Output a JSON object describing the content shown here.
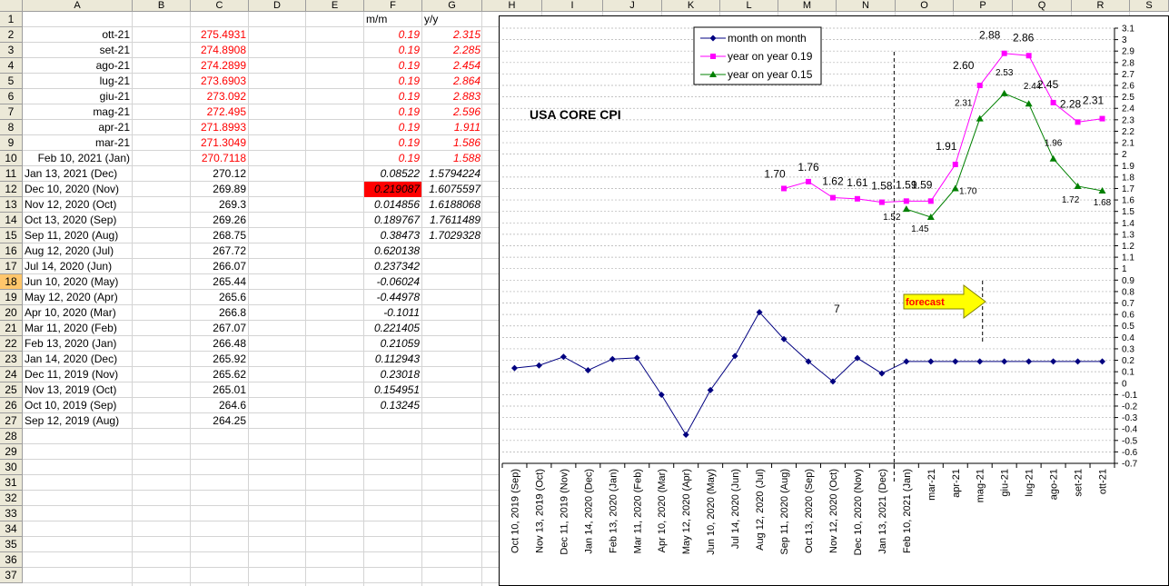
{
  "columns": [
    "A",
    "B",
    "C",
    "D",
    "E",
    "F",
    "G",
    "H",
    "I",
    "J",
    "K",
    "L",
    "M",
    "N",
    "O",
    "P",
    "Q",
    "R",
    "S"
  ],
  "header_row": {
    "F": "m/m",
    "G": "y/y"
  },
  "rows": [
    {
      "a": "ott-21",
      "c": "275.4931",
      "f": "0.19",
      "g": "2.315",
      "forecast": true
    },
    {
      "a": "set-21",
      "c": "274.8908",
      "f": "0.19",
      "g": "2.285",
      "forecast": true
    },
    {
      "a": "ago-21",
      "c": "274.2899",
      "f": "0.19",
      "g": "2.454",
      "forecast": true
    },
    {
      "a": "lug-21",
      "c": "273.6903",
      "f": "0.19",
      "g": "2.864",
      "forecast": true
    },
    {
      "a": "giu-21",
      "c": "273.092",
      "f": "0.19",
      "g": "2.883",
      "forecast": true
    },
    {
      "a": "mag-21",
      "c": "272.495",
      "f": "0.19",
      "g": "2.596",
      "forecast": true
    },
    {
      "a": "apr-21",
      "c": "271.8993",
      "f": "0.19",
      "g": "1.911",
      "forecast": true
    },
    {
      "a": "mar-21",
      "c": "271.3049",
      "f": "0.19",
      "g": "1.586",
      "forecast": true
    },
    {
      "a": "Feb 10, 2021 (Jan)",
      "c": "270.7118",
      "f": "0.19",
      "g": "1.588",
      "forecast": true
    },
    {
      "a": "Jan 13, 2021 (Dec)",
      "c": "270.12",
      "f": "0.08522",
      "g": "1.5794224"
    },
    {
      "a": "Dec 10, 2020 (Nov)",
      "c": "269.89",
      "f": "0.219087",
      "g": "1.6075597",
      "highlight": true
    },
    {
      "a": "Nov 12, 2020 (Oct)",
      "c": "269.3",
      "f": "0.014856",
      "g": "1.6188068"
    },
    {
      "a": "Oct 13, 2020 (Sep)",
      "c": "269.26",
      "f": "0.189767",
      "g": "1.7611489"
    },
    {
      "a": "Sep 11, 2020 (Aug)",
      "c": "268.75",
      "f": "0.38473",
      "g": "1.7029328"
    },
    {
      "a": "Aug 12, 2020 (Jul)",
      "c": "267.72",
      "f": "0.620138",
      "g": ""
    },
    {
      "a": "Jul 14, 2020 (Jun)",
      "c": "266.07",
      "f": "0.237342",
      "g": ""
    },
    {
      "a": "Jun 10, 2020 (May)",
      "c": "265.44",
      "f": "-0.06024",
      "g": ""
    },
    {
      "a": "May 12, 2020 (Apr)",
      "c": "265.6",
      "f": "-0.44978",
      "g": ""
    },
    {
      "a": "Apr 10, 2020 (Mar)",
      "c": "266.8",
      "f": "-0.1011",
      "g": ""
    },
    {
      "a": "Mar 11, 2020 (Feb)",
      "c": "267.07",
      "f": "0.221405",
      "g": ""
    },
    {
      "a": "Feb 13, 2020 (Jan)",
      "c": "266.48",
      "f": "0.21059",
      "g": ""
    },
    {
      "a": "Jan 14, 2020 (Dec)",
      "c": "265.92",
      "f": "0.112943",
      "g": ""
    },
    {
      "a": "Dec 11, 2019 (Nov)",
      "c": "265.62",
      "f": "0.23018",
      "g": ""
    },
    {
      "a": "Nov 13, 2019 (Oct)",
      "c": "265.01",
      "f": "0.154951",
      "g": ""
    },
    {
      "a": "Oct 10, 2019 (Sep)",
      "c": "264.6",
      "f": "0.13245",
      "g": ""
    },
    {
      "a": "Sep 12, 2019 (Aug)",
      "c": "264.25",
      "f": "",
      "g": ""
    }
  ],
  "row_count": 37,
  "selected_row": 18,
  "chart_data": {
    "type": "line",
    "title": "USA CORE CPI",
    "categories": [
      "Oct 10, 2019 (Sep)",
      "Nov 13, 2019 (Oct)",
      "Dec 11, 2019 (Nov)",
      "Jan 14, 2020 (Dec)",
      "Feb 13, 2020 (Jan)",
      "Mar 11, 2020 (Feb)",
      "Apr 10, 2020 (Mar)",
      "May 12, 2020 (Apr)",
      "Jun 10, 2020 (May)",
      "Jul 14, 2020 (Jun)",
      "Aug 12, 2020 (Jul)",
      "Sep 11, 2020 (Aug)",
      "Oct 13, 2020 (Sep)",
      "Nov 12, 2020 (Oct)",
      "Dec 10, 2020 (Nov)",
      "Jan 13, 2021 (Dec)",
      "Feb 10, 2021 (Jan)",
      "mar-21",
      "apr-21",
      "mag-21",
      "giu-21",
      "lug-21",
      "ago-21",
      "set-21",
      "ott-21"
    ],
    "series": [
      {
        "name": "month on month",
        "color": "#000080",
        "marker": "diamond",
        "values": [
          0.13245,
          0.154951,
          0.23018,
          0.112943,
          0.21059,
          0.221405,
          -0.1011,
          -0.44978,
          -0.06024,
          0.237342,
          0.620138,
          0.38473,
          0.189767,
          0.014856,
          0.219087,
          0.08522,
          0.19,
          0.19,
          0.19,
          0.19,
          0.19,
          0.19,
          0.19,
          0.19,
          0.19
        ]
      },
      {
        "name": "year on year 0.19",
        "color": "#ff00ff",
        "marker": "square",
        "values": [
          null,
          null,
          null,
          null,
          null,
          null,
          null,
          null,
          null,
          null,
          null,
          1.7,
          1.76,
          1.62,
          1.61,
          1.58,
          1.59,
          1.59,
          1.91,
          2.6,
          2.88,
          2.86,
          2.45,
          2.28,
          2.31
        ],
        "labels": [
          null,
          null,
          null,
          null,
          null,
          null,
          null,
          null,
          null,
          null,
          null,
          "1.70",
          "1.76",
          "1.62",
          "1.61",
          "1.58",
          "1.59",
          "1.59",
          "1.91",
          "2.60",
          "2.88",
          "2.86",
          "2.45",
          "2.28",
          "2.31"
        ]
      },
      {
        "name": "year on year 0.15",
        "color": "#008000",
        "marker": "triangle",
        "values": [
          null,
          null,
          null,
          null,
          null,
          null,
          null,
          null,
          null,
          null,
          null,
          null,
          null,
          null,
          null,
          null,
          1.52,
          1.45,
          1.7,
          2.31,
          2.53,
          2.44,
          1.96,
          1.72,
          1.68
        ],
        "labels": [
          null,
          null,
          null,
          null,
          null,
          null,
          null,
          null,
          null,
          null,
          null,
          null,
          null,
          null,
          null,
          null,
          "1.52",
          "1.45",
          "1.70",
          "2.31",
          "2.53",
          "2.44",
          "1.96",
          "1.72",
          "1.68"
        ]
      }
    ],
    "ylim": [
      -0.7,
      3.1
    ],
    "ytick_step": 0.1,
    "ytick_labels": [
      "3.1",
      "3",
      "2.9",
      "2.8",
      "2.7",
      "2.6",
      "2.5",
      "2.4",
      "2.3",
      "2.2",
      "2.1",
      "2",
      "1.9",
      "1.8",
      "1.7",
      "1.6",
      "1.5",
      "1.4",
      "1.3",
      "1.2",
      "1.1",
      "1",
      "0.9",
      "0.8",
      "0.7",
      "0.6",
      "0.5",
      "0.4",
      "0.3",
      "0.2",
      "0.1",
      "0",
      "-0.1",
      "-0.2",
      "-0.3",
      "-0.4",
      "-0.5",
      "-0.6",
      "-0.7"
    ],
    "y_axis_side": "right",
    "grid": "horizontal dashed",
    "legend_position": "top-center",
    "annotations": {
      "forecast_label": "forecast",
      "stray_label": "7"
    },
    "forecast_start_category": "Feb 10, 2021 (Jan)"
  }
}
